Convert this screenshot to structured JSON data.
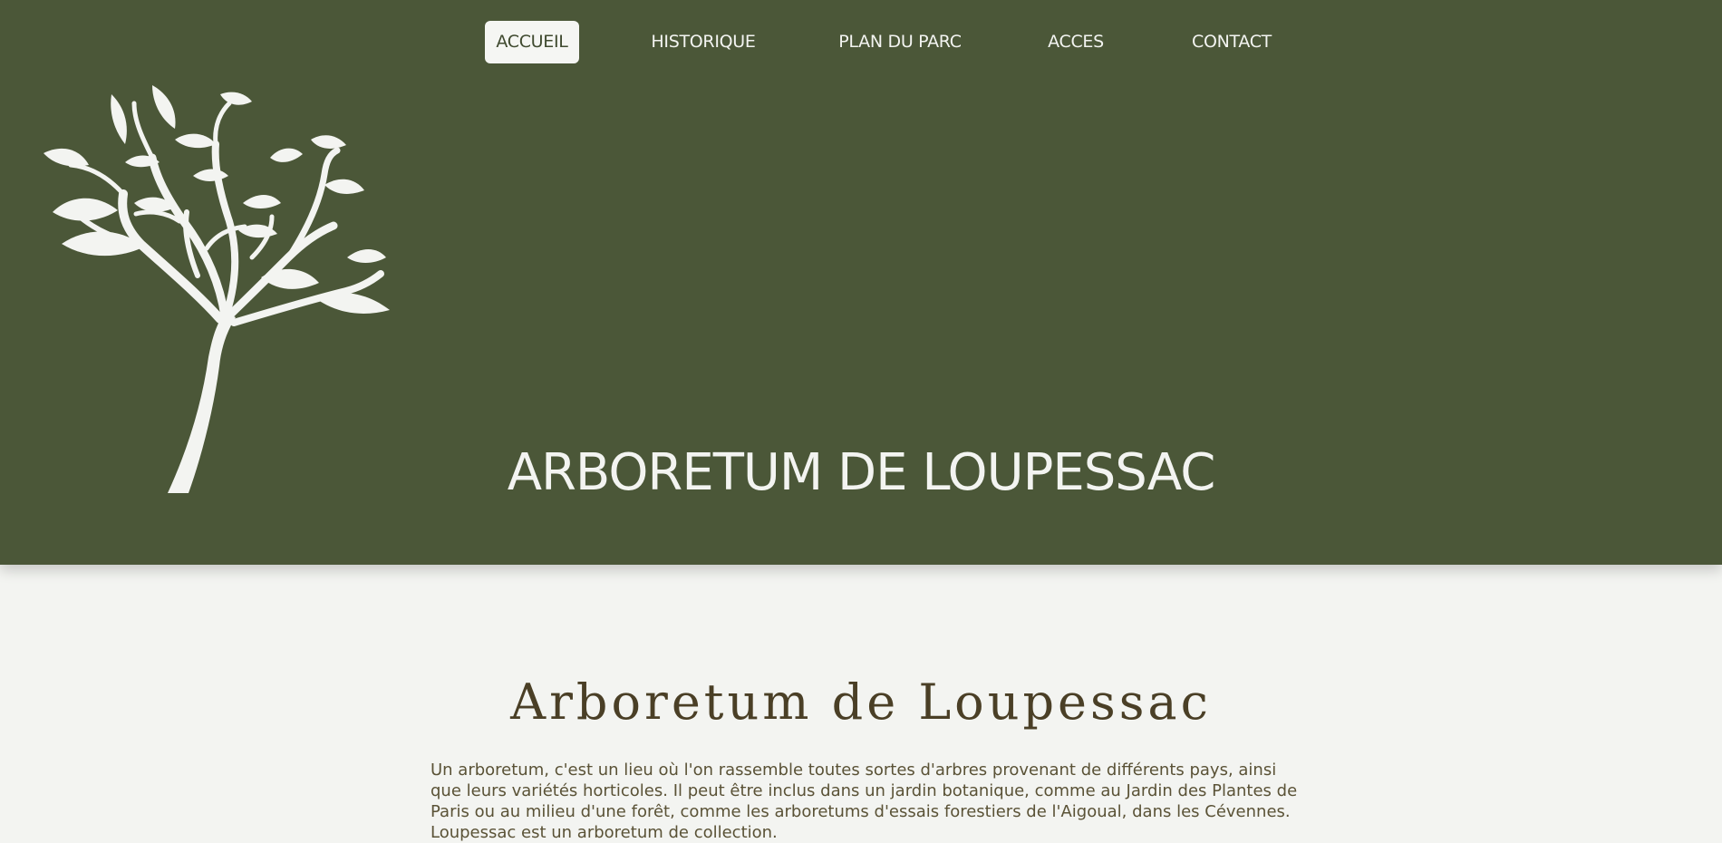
{
  "nav": {
    "items": [
      {
        "label": "ACCUEIL",
        "active": true
      },
      {
        "label": "HISTORIQUE",
        "active": false
      },
      {
        "label": "PLAN DU PARC",
        "active": false
      },
      {
        "label": "ACCES",
        "active": false
      },
      {
        "label": "CONTACT",
        "active": false
      }
    ]
  },
  "hero": {
    "logo_icon": "tree-logo-icon",
    "title": "ARBORETUM DE LOUPESSAC"
  },
  "main": {
    "title": "Arboretum de Loupessac",
    "intro": "Un arboretum, c'est un lieu où l'on rassemble toutes sortes d'arbres provenant de différents pays, ainsi que leurs variétés horticoles. Il peut être inclus dans un jardin botanique, comme au Jardin des Plantes de Paris ou au milieu d'une forêt, comme les arboretums d'essais forestiers de l'Aigoual, dans les Cévennes. Loupessac est un arboretum de collection."
  },
  "colors": {
    "hero_background": "#4b5738",
    "page_background": "#f3f4f1",
    "title_color": "#4a3f26",
    "text_color": "#5a5236"
  }
}
